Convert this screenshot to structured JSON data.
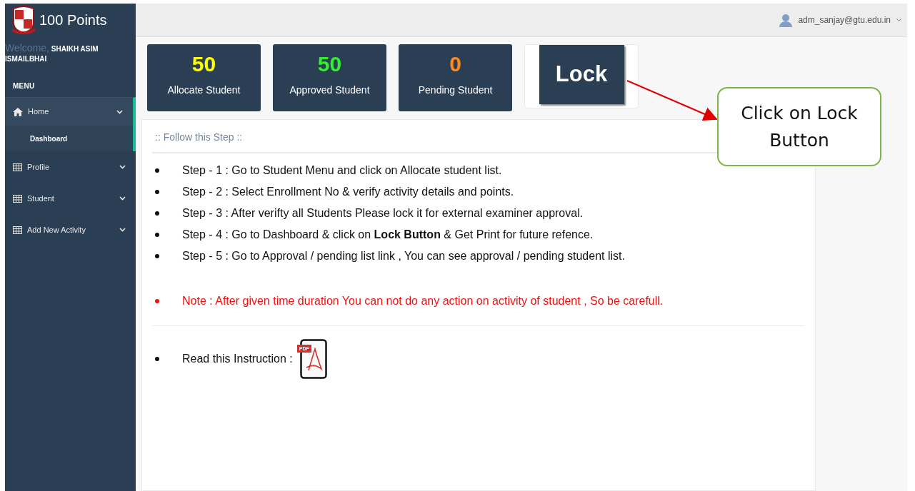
{
  "sidebar": {
    "brand": "100 Points",
    "welcome": "Welcome,",
    "user_name": "SHAIKH ASIM ISMAILBHAI",
    "menu_title": "MENU",
    "items": [
      {
        "label": "Home",
        "kind": "home",
        "selected": true,
        "children": [
          {
            "label": "Dashboard",
            "selected": true
          }
        ]
      },
      {
        "label": "Profile",
        "kind": "table",
        "selected": false
      },
      {
        "label": "Student",
        "kind": "table",
        "selected": false
      },
      {
        "label": "Add New Activity",
        "kind": "table",
        "selected": false
      }
    ]
  },
  "top_bar": {
    "user": "adm_sanjay@gtu.edu.in"
  },
  "stats": [
    {
      "value": "50",
      "label": "Allocate Student",
      "color": "#ffff00"
    },
    {
      "value": "50",
      "label": "Approved Student",
      "color": "#33ee33"
    },
    {
      "value": "0",
      "label": "Pending Student",
      "color": "#ff8c1a"
    }
  ],
  "lock_button": "Lock",
  "panel": {
    "title": ":: Follow this Step ::",
    "steps": [
      "Step - 1 : Go to Student Menu and click on Allocate student list.",
      "Step - 2 : Select Enrollment No & verify activity details and points.",
      "Step - 3 : After verifty all Students Please lock it for external examiner approval.",
      "Step - 4 : Go to Dashboard & click on **Lock Button** & Get Print for future refence.",
      "Step - 5 : Go to Approval / pending list link , You can see approval / pending student list."
    ],
    "note": "Note : After given time duration You can not do any action on activity of student , So be carefull.",
    "instruction": "Read this Instruction :",
    "pdf_badge": "PDF"
  },
  "callout": "Click on Lock Button"
}
